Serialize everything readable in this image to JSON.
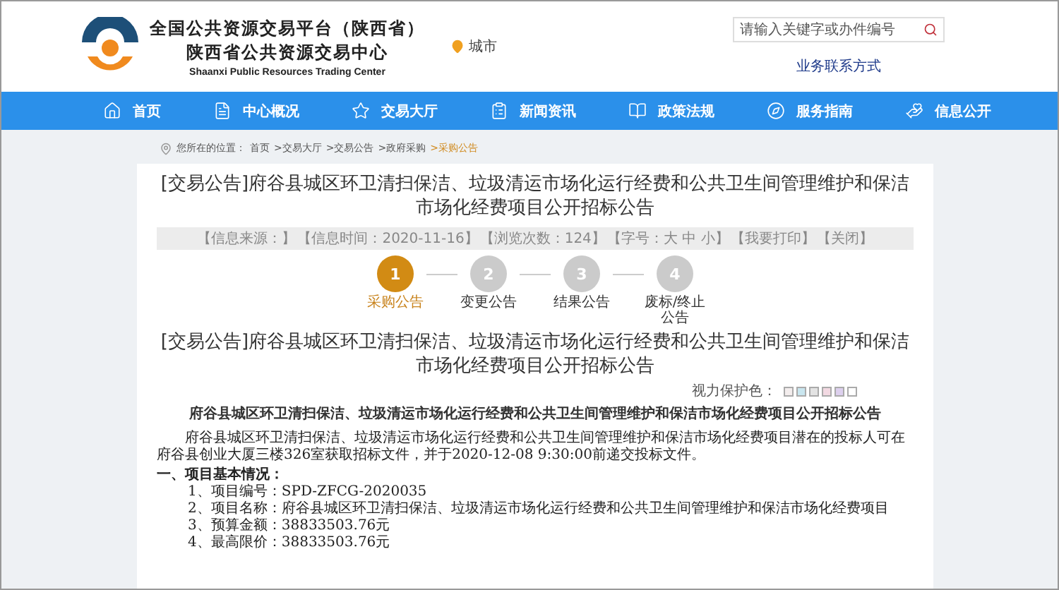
{
  "header": {
    "logo_title_cn": "全国公共资源交易平台（陕西省）",
    "logo_subtitle_cn": "陕西省公共资源交易中心",
    "logo_title_en": "Shaanxi Public Resources Trading Center",
    "city": "城市",
    "search": {
      "placeholder": "请输入关键字或办件编号"
    },
    "contact_link": "业务联系方式"
  },
  "nav": [
    {
      "label": "首页",
      "kind": "home"
    },
    {
      "label": "中心概况",
      "kind": "doc"
    },
    {
      "label": "交易大厅",
      "kind": "star"
    },
    {
      "label": "新闻资讯",
      "kind": "list"
    },
    {
      "label": "政策法规",
      "kind": "book"
    },
    {
      "label": "服务指南",
      "kind": "compass"
    },
    {
      "label": "信息公开",
      "kind": "hand"
    }
  ],
  "breadcrumb": {
    "label": "您所在的位置：",
    "items": [
      "首页",
      ">交易大厅",
      ">交易公告",
      ">政府采购",
      ">采购公告"
    ]
  },
  "article": {
    "title": "[交易公告]府谷县城区环卫清扫保洁、垃圾清运市场化运行经费和公共卫生间管理维护和保洁市场化经费项目公开招标公告",
    "meta": [
      "【信息来源：】",
      "【信息时间：2020-11-16】",
      "【浏览次数：124】",
      "【字号：大 中 小】",
      "【我要打印】",
      "【关闭】"
    ],
    "steps": [
      {
        "number": "1",
        "label": "采购公告",
        "selected": true
      },
      {
        "number": "2",
        "label": "变更公告",
        "selected": false
      },
      {
        "number": "3",
        "label": "结果公告",
        "selected": false
      },
      {
        "number": "4",
        "label": "废标/终止公告",
        "selected": false
      }
    ],
    "subtitle": "[交易公告]府谷县城区环卫清扫保洁、垃圾清运市场化运行经费和公共卫生间管理维护和保洁市场化经费项目公开招标公告",
    "eye_care": {
      "label": "视力保护色：",
      "swatches": [
        {
          "color": "#f3eded"
        },
        {
          "color": "#c9e6ef"
        },
        {
          "color": "#e3e3e3"
        },
        {
          "color": "#f2d9e2"
        },
        {
          "color": "#ddd0ee"
        },
        {
          "color": "#ffffff"
        }
      ]
    },
    "doc_title": "府谷县城区环卫清扫保洁、垃圾清运市场化运行经费和公共卫生间管理维护和保洁市场化经费项目公开招标公告",
    "intro": "府谷县城区环卫清扫保洁、垃圾清运市场化运行经费和公共卫生间管理维护和保洁市场化经费项目潜在的投标人可在府谷县创业大厦三楼326室获取招标文件，并于2020-12-08 9:30:00前递交投标文件。",
    "section_heading": "一、项目基本情况：",
    "items": [
      "1、项目编号：SPD-ZFCG-2020035",
      "2、项目名称：府谷县城区环卫清扫保洁、垃圾清运市场化运行经费和公共卫生间管理维护和保洁市场化经费项目",
      "3、预算金额：38833503.76元",
      "4、最高限价：38833503.76元"
    ]
  }
}
